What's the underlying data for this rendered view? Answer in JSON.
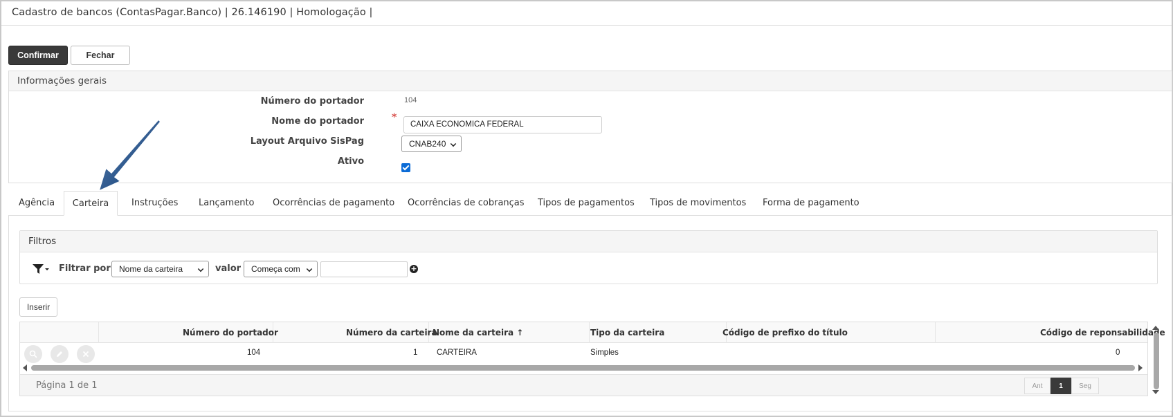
{
  "window": {
    "title": "Cadastro de bancos (ContasPagar.Banco) | 26.146190 | Homologação |"
  },
  "toolbar": {
    "confirm_label": "Confirmar",
    "close_label": "Fechar"
  },
  "general": {
    "header": "Informações gerais",
    "portador_number_label": "Número do portador",
    "portador_number_value": "104",
    "portador_name_label": "Nome do portador",
    "portador_name_value": "CAIXA ECONOMICA FEDERAL",
    "required_mark": "*",
    "layout_label": "Layout Arquivo SisPag",
    "layout_value": "CNAB240",
    "active_label": "Ativo",
    "active_checked": true
  },
  "tabs": [
    {
      "label": "Agência"
    },
    {
      "label": "Carteira"
    },
    {
      "label": "Instruções"
    },
    {
      "label": "Lançamento"
    },
    {
      "label": "Ocorrências de pagamento"
    },
    {
      "label": "Ocorrências de cobranças"
    },
    {
      "label": "Tipos de pagamentos"
    },
    {
      "label": "Tipos de movimentos"
    },
    {
      "label": "Forma de pagamento"
    }
  ],
  "active_tab": "Carteira",
  "filters": {
    "header": "Filtros",
    "filter_by_label": "Filtrar por",
    "field_select": "Nome da carteira",
    "value_label": "valor",
    "operator_select": "Começa com",
    "value_input": ""
  },
  "insert_label": "Inserir",
  "table": {
    "columns": [
      "Número do portador",
      "Número da carteira",
      "Nome da carteira",
      "Tipo da carteira",
      "Código de prefixo do título",
      "Código de reponsabilidade"
    ],
    "sort_indicator": "↑",
    "rows": [
      {
        "portador": "104",
        "numero_carteira": "1",
        "nome_carteira": "CARTEIRA",
        "tipo_carteira": "Simples",
        "prefixo": "",
        "responsabilidade": "0"
      }
    ]
  },
  "pagination": {
    "info": "Página 1 de 1",
    "prev_label": "Ant",
    "current_page": "1",
    "next_label": "Seg"
  },
  "colors": {
    "primary_button": "#3a3a3a",
    "checkbox": "#0b6bd6",
    "required": "#d9534f",
    "annotation_arrow": "#0d3b72"
  }
}
